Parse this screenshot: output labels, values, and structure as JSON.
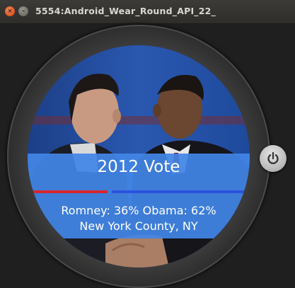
{
  "window": {
    "title": "5554:Android_Wear_Round_API_22_",
    "close_glyph": "×",
    "minimize_glyph": "–"
  },
  "watch": {
    "title": "2012 Vote",
    "results": "Romney: 36%  Obama: 62%",
    "location": "New York County, NY",
    "romney_fraction": 0.36,
    "obama_fraction": 0.62,
    "romney_color": "#d8262e",
    "obama_color": "#2c52e0",
    "overlay_color": "#4285e6"
  },
  "icons": {
    "power": "power-icon",
    "photo": "candidates-photo"
  }
}
